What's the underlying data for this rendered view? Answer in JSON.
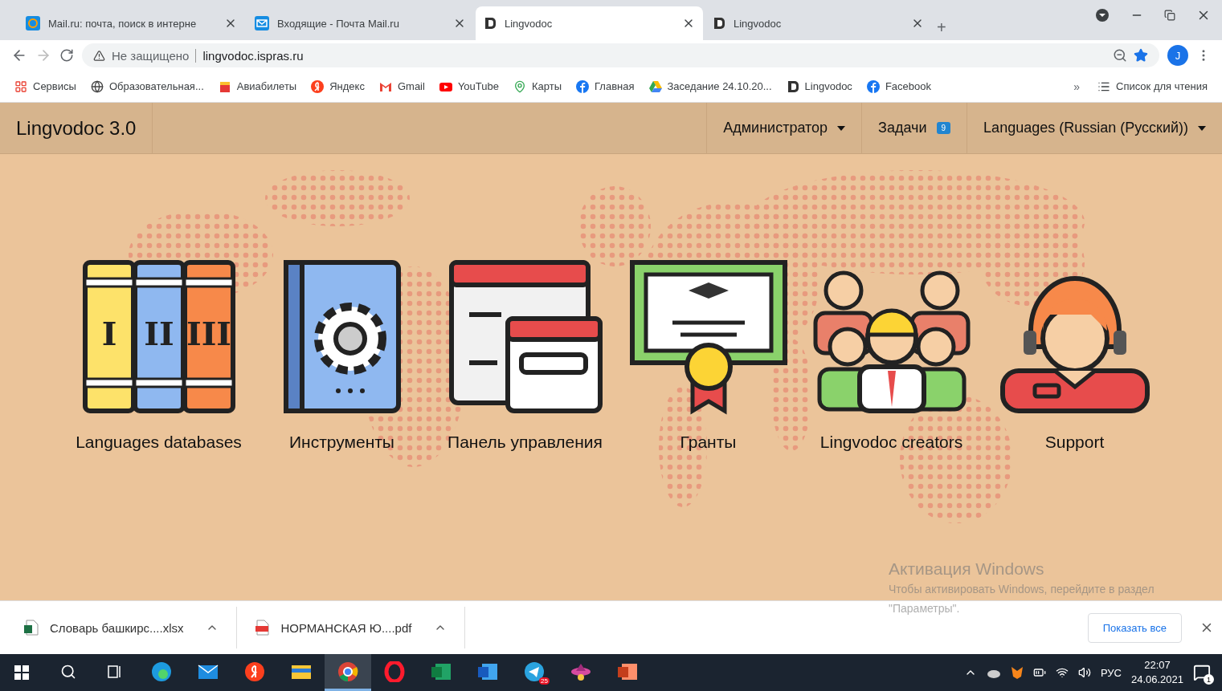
{
  "browser": {
    "tabs": [
      {
        "title": "Mail.ru: почта, поиск в интерне",
        "kind": "at",
        "selected": false
      },
      {
        "title": "Входящие - Почта Mail.ru",
        "kind": "envelope",
        "selected": false
      },
      {
        "title": "Lingvodoc",
        "kind": "doc",
        "selected": true
      },
      {
        "title": "Lingvodoc",
        "kind": "doc",
        "selected": false
      }
    ],
    "new_tab": "+",
    "address": {
      "warning": "Не защищено",
      "url": "lingvodoc.ispras.ru"
    },
    "profile": "J",
    "bookmarks": [
      {
        "label": "Сервисы",
        "kind": "apps"
      },
      {
        "label": "Образовательная...",
        "kind": "globe"
      },
      {
        "label": "Авиабилеты",
        "kind": "ticket"
      },
      {
        "label": "Яндекс",
        "kind": "yandex"
      },
      {
        "label": "Gmail",
        "kind": "gmail"
      },
      {
        "label": "YouTube",
        "kind": "youtube"
      },
      {
        "label": "Карты",
        "kind": "pin"
      },
      {
        "label": "Главная",
        "kind": "facebook"
      },
      {
        "label": "Заседание 24.10.20...",
        "kind": "drive"
      },
      {
        "label": "Lingvodoc",
        "kind": "doc"
      },
      {
        "label": "Facebook",
        "kind": "facebook"
      }
    ],
    "bookmarks_more": "»",
    "reading_list": "Список для чтения"
  },
  "app": {
    "brand": "Lingvodoc 3.0",
    "menu": [
      {
        "label": "Администратор",
        "kind": "dropdown"
      },
      {
        "label": "Задачи",
        "kind": "badge",
        "badge": "9"
      },
      {
        "label": "Languages (Russian (Русский))",
        "kind": "dropdown"
      }
    ],
    "tiles": [
      {
        "label": "Languages databases",
        "kind": "books",
        "numerals": [
          "I",
          "II",
          "III"
        ]
      },
      {
        "label": "Инструменты",
        "kind": "gearbook"
      },
      {
        "label": "Панель управления",
        "kind": "windows"
      },
      {
        "label": "Гранты",
        "kind": "certificate"
      },
      {
        "label": "Lingvodoc creators",
        "kind": "team"
      },
      {
        "label": "Support",
        "kind": "support"
      }
    ]
  },
  "activation": {
    "title": "Активация Windows",
    "text": "Чтобы активировать Windows, перейдите в раздел \"Параметры\"."
  },
  "downloads": {
    "files": [
      {
        "name": "Словарь башкирс....xlsx",
        "kind": "xlsx"
      },
      {
        "name": "НОРМАНСКАЯ Ю....pdf",
        "kind": "pdf"
      }
    ],
    "show_all": "Показать все"
  },
  "taskbar": {
    "apps": [
      {
        "kind": "search",
        "selected": false
      },
      {
        "kind": "taskview",
        "selected": false
      },
      {
        "kind": "edge",
        "selected": false
      },
      {
        "kind": "mail",
        "selected": false
      },
      {
        "kind": "yandex",
        "selected": false
      },
      {
        "kind": "explorer",
        "selected": false
      },
      {
        "kind": "chrome",
        "selected": true
      },
      {
        "kind": "opera",
        "selected": false
      },
      {
        "kind": "excel",
        "selected": false
      },
      {
        "kind": "word",
        "selected": false
      },
      {
        "kind": "telegram",
        "selected": false,
        "badge": "25"
      },
      {
        "kind": "game",
        "selected": false
      },
      {
        "kind": "powerpoint",
        "selected": false
      }
    ],
    "language": "РУС",
    "time": "22:07",
    "date": "24.06.2021",
    "notifications": "1"
  }
}
